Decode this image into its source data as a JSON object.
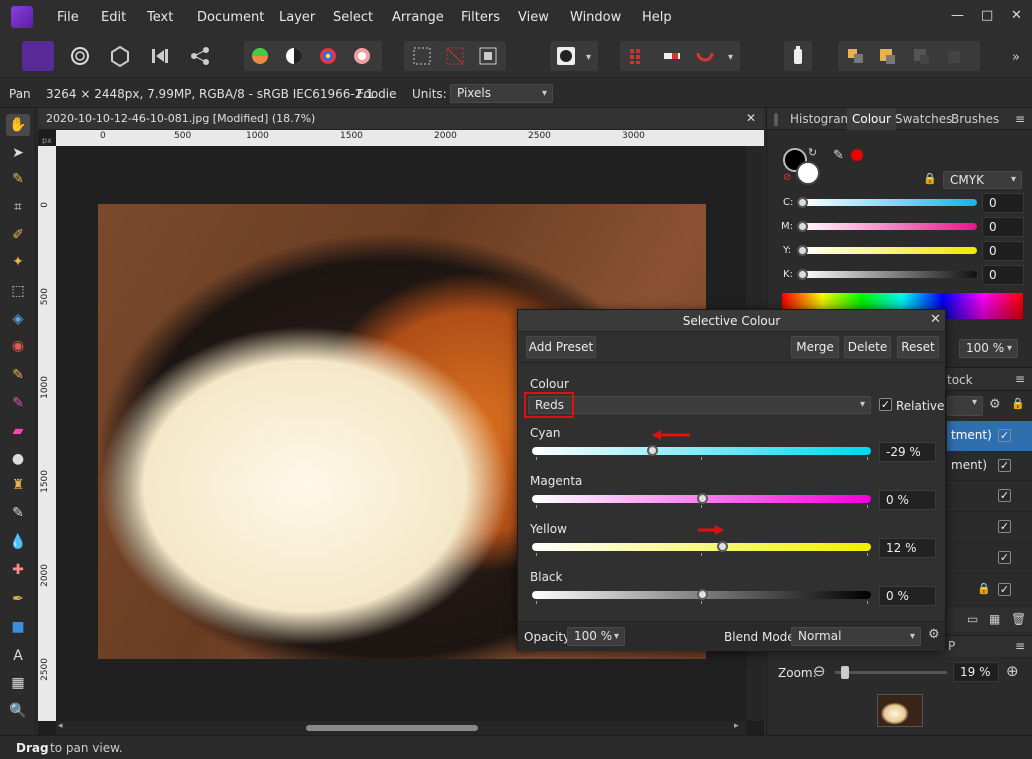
{
  "menu": [
    "File",
    "Edit",
    "Text",
    "Document",
    "Layer",
    "Select",
    "Arrange",
    "Filters",
    "View",
    "Window",
    "Help"
  ],
  "window_controls": {
    "min": "—",
    "max": "□",
    "close": "✕"
  },
  "context": {
    "tool": "Pan",
    "info": "3264 × 2448px, 7.99MP, RGBA/8 - sRGB IEC61966-2.1",
    "preset": "Foodie",
    "units_label": "Units:",
    "units_value": "Pixels"
  },
  "document": {
    "tab_title": "2020-10-10-12-46-10-081.jpg [Modified] (18.7%)",
    "ruler_unit": "px",
    "h_ticks": [
      "0",
      "500",
      "1000",
      "1500",
      "2000",
      "2500",
      "3000"
    ],
    "v_ticks": [
      "0",
      "500",
      "1000",
      "1500",
      "2000",
      "2500"
    ]
  },
  "right_panel": {
    "tabs": [
      "Histogram",
      "Colour",
      "Swatches",
      "Brushes"
    ],
    "active_tab": "Colour",
    "colour_model": "CMYK",
    "channels": [
      {
        "label": "C:",
        "value": "0"
      },
      {
        "label": "M:",
        "value": "0"
      },
      {
        "label": "Y:",
        "value": "0"
      },
      {
        "label": "K:",
        "value": "0"
      }
    ],
    "opacity_value": "100 %",
    "layers_tab_fragment": "tock",
    "layer_rows": [
      "tment)",
      "ment)",
      "",
      "",
      "",
      ""
    ],
    "zoom_label": "Zoom:",
    "zoom_value": "19 %",
    "p_fragment": "P"
  },
  "dialog": {
    "title": "Selective Colour",
    "add_preset": "Add Preset",
    "merge": "Merge",
    "delete": "Delete",
    "reset": "Reset",
    "colour_label": "Colour",
    "colour_value": "Reds",
    "relative_label": "Relative",
    "sliders": [
      {
        "label": "Cyan",
        "value": "-29 %",
        "fraction": 0.355,
        "from": "#ffffff",
        "to": "#00d7f0"
      },
      {
        "label": "Magenta",
        "value": "0 %",
        "fraction": 0.5,
        "from": "#ffffff",
        "to": "#f000e0"
      },
      {
        "label": "Yellow",
        "value": "12 %",
        "fraction": 0.56,
        "from": "#ffffff",
        "to": "#f2f000"
      },
      {
        "label": "Black",
        "value": "0 %",
        "fraction": 0.5,
        "from": "#ffffff",
        "to": "#000000"
      }
    ],
    "opacity_label": "Opacity:",
    "opacity_value": "100 %",
    "blend_label": "Blend Mode:",
    "blend_value": "Normal"
  },
  "status": {
    "bold": "Drag",
    "rest": " to pan view."
  },
  "colors": {
    "accent": "#2f6fb0",
    "highlight_box": "#e01010",
    "arrow": "#e01010"
  }
}
